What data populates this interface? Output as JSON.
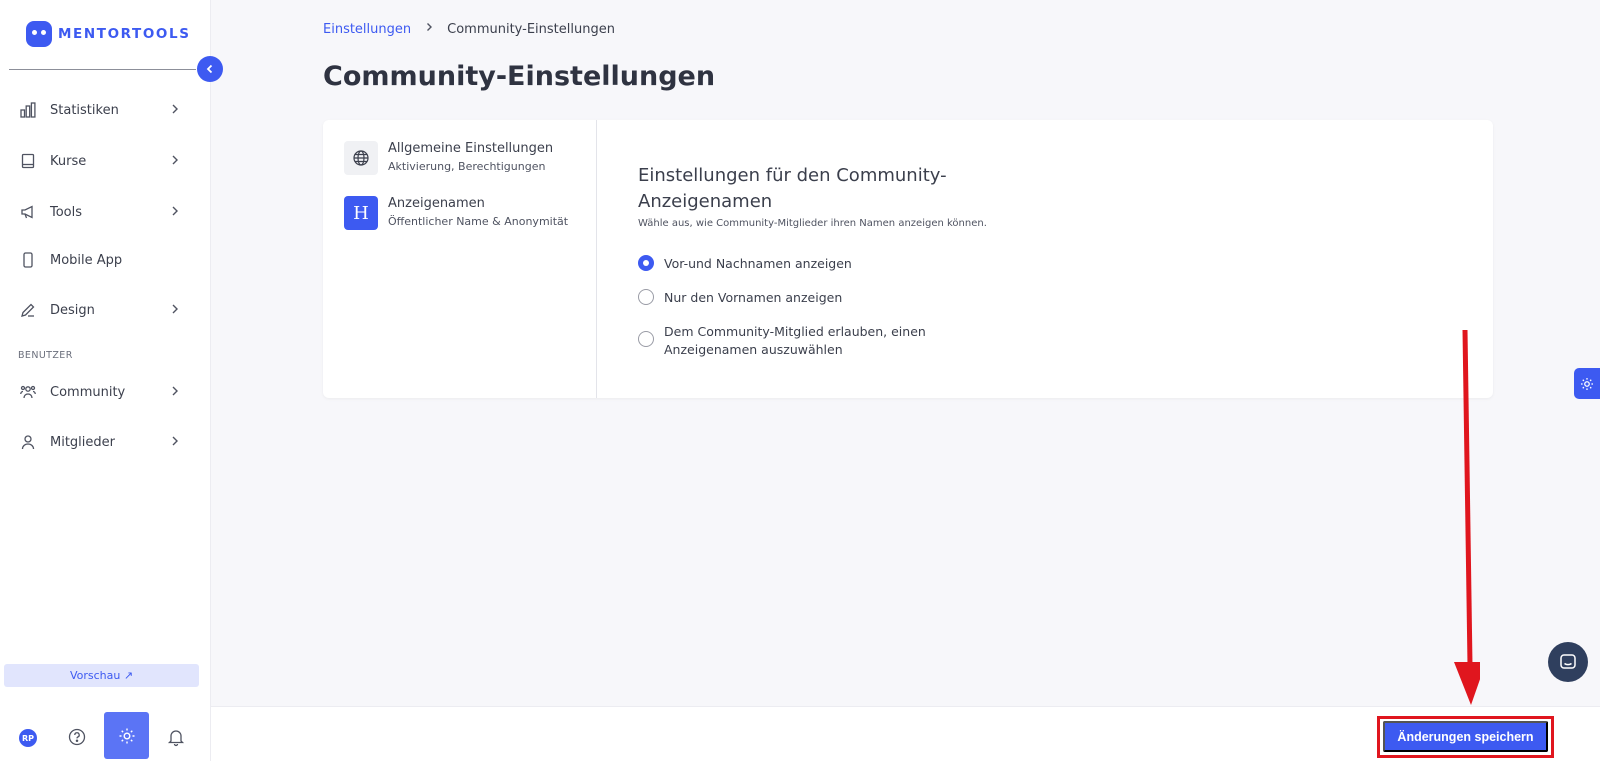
{
  "brand": {
    "name": "MENTORTOOLS",
    "color": "#3d5af1"
  },
  "sidebar": {
    "collapse_icon": "chevron-left-icon",
    "items": [
      {
        "label": "Statistiken",
        "icon": "bar-chart-icon",
        "has_chevron": true
      },
      {
        "label": "Kurse",
        "icon": "book-icon",
        "has_chevron": true
      },
      {
        "label": "Tools",
        "icon": "megaphone-icon",
        "has_chevron": true
      },
      {
        "label": "Mobile App",
        "icon": "phone-icon",
        "has_chevron": false
      },
      {
        "label": "Design",
        "icon": "pencil-icon",
        "has_chevron": true
      }
    ],
    "section_label": "BENUTZER",
    "user_items": [
      {
        "label": "Community",
        "icon": "people-icon",
        "has_chevron": true
      },
      {
        "label": "Mitglieder",
        "icon": "user-icon",
        "has_chevron": true
      }
    ],
    "preview_label": "Vorschau ↗",
    "bottom": {
      "avatar_initials": "RP",
      "help_icon": "question-icon",
      "settings_icon": "gear-icon",
      "bell_icon": "bell-icon"
    }
  },
  "breadcrumb": {
    "parent": "Einstellungen",
    "separator": "›",
    "current": "Community-Einstellungen"
  },
  "page_title": "Community-Einstellungen",
  "settings_tabs": [
    {
      "title": "Allgemeine Einstellungen",
      "subtitle": "Aktivierung, Berechtigungen",
      "icon": "globe-icon",
      "active": false
    },
    {
      "title": "Anzeigenamen",
      "subtitle": "Öffentlicher Name & Anonymität",
      "icon": "h-letter-icon",
      "glyph": "H",
      "active": true
    }
  ],
  "panel": {
    "title": "Einstellungen für den Community-Anzeigenamen",
    "description": "Wähle aus, wie Community-Mitglieder ihren Namen anzeigen können.",
    "options": [
      {
        "label": "Vor-und Nachnamen anzeigen",
        "checked": true
      },
      {
        "label": "Nur den Vornamen anzeigen",
        "checked": false
      },
      {
        "label": "Dem Community-Mitglied erlauben, einen Anzeigenamen auszuwählen",
        "checked": false
      }
    ]
  },
  "footer": {
    "save_label": "Änderungen speichern",
    "highlight_color": "#e0161e"
  }
}
